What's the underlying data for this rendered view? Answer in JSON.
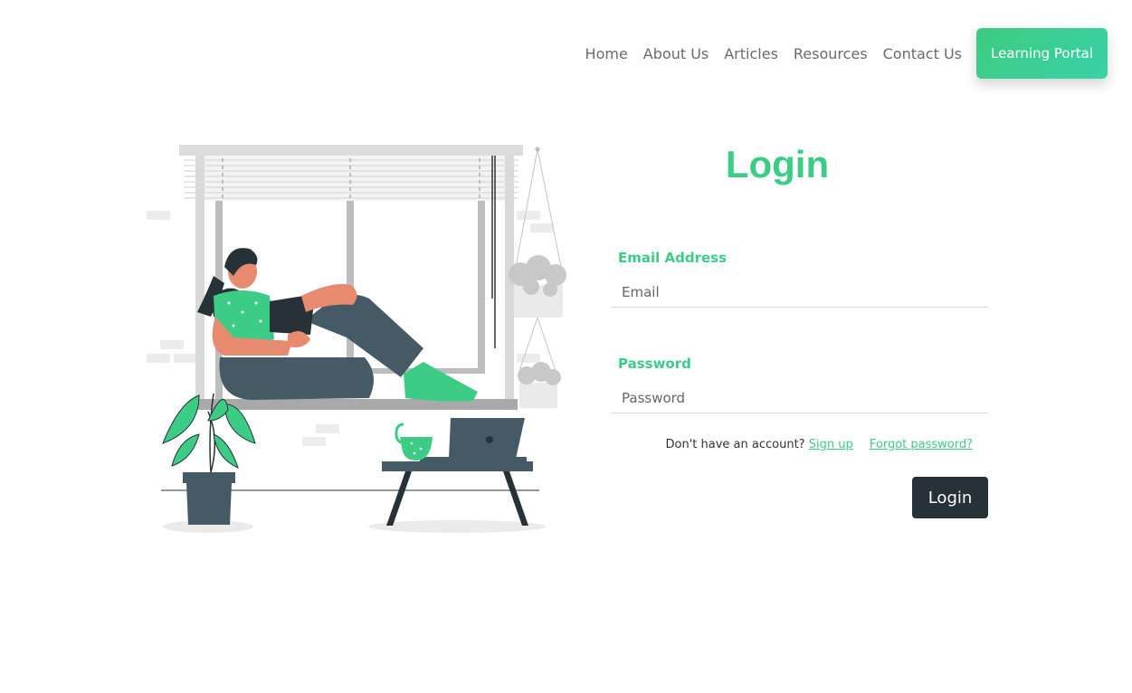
{
  "nav": {
    "links": [
      "Home",
      "About Us",
      "Articles",
      "Resources",
      "Contact Us"
    ],
    "portal_button": "Learning Portal"
  },
  "form": {
    "title": "Login",
    "email": {
      "label": "Email Address",
      "placeholder": "Email",
      "value": ""
    },
    "password": {
      "label": "Password",
      "placeholder": "Password",
      "value": ""
    },
    "no_account_text": "Don't have an account?",
    "signup_link": "Sign up",
    "forgot_link": "Forgot password?",
    "submit_label": "Login"
  },
  "colors": {
    "accent_green": "#3ccc85",
    "dark_button": "#263238",
    "illustration_dark": "#455a64"
  }
}
